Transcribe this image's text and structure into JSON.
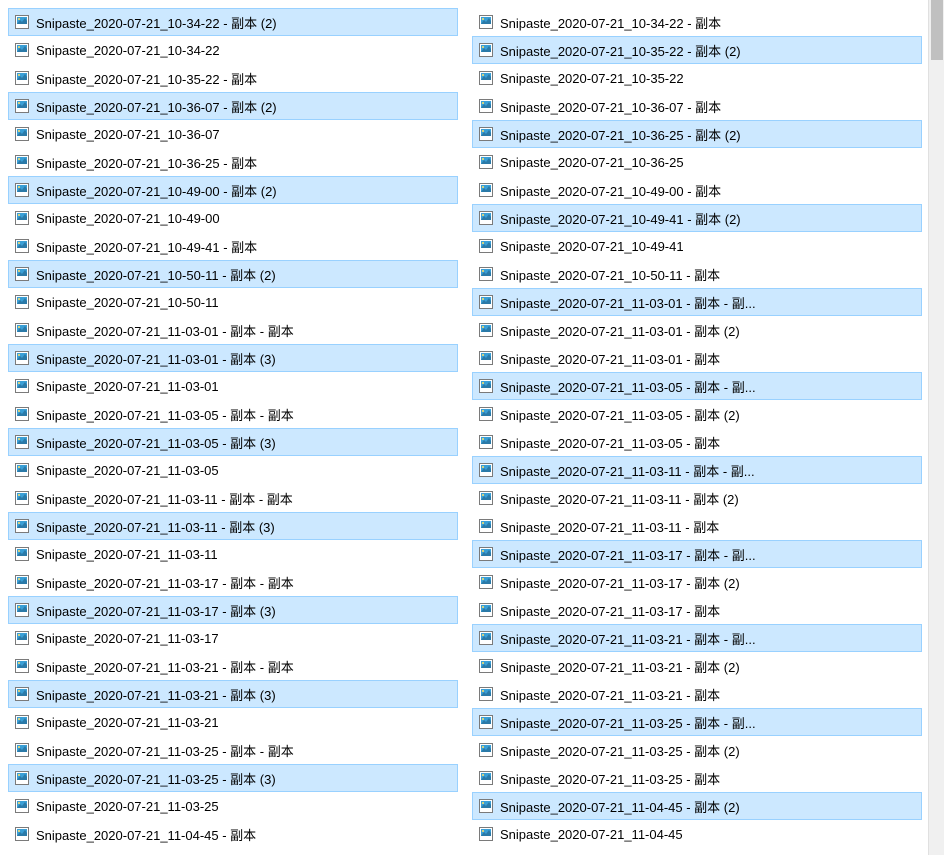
{
  "columns": {
    "left": [
      {
        "label": "Snipaste_2020-07-21_10-34-22 - 副本 (2)",
        "selected": true
      },
      {
        "label": "Snipaste_2020-07-21_10-34-22",
        "selected": false
      },
      {
        "label": "Snipaste_2020-07-21_10-35-22 - 副本",
        "selected": false
      },
      {
        "label": "Snipaste_2020-07-21_10-36-07 - 副本 (2)",
        "selected": true
      },
      {
        "label": "Snipaste_2020-07-21_10-36-07",
        "selected": false
      },
      {
        "label": "Snipaste_2020-07-21_10-36-25 - 副本",
        "selected": false
      },
      {
        "label": "Snipaste_2020-07-21_10-49-00 - 副本 (2)",
        "selected": true
      },
      {
        "label": "Snipaste_2020-07-21_10-49-00",
        "selected": false
      },
      {
        "label": "Snipaste_2020-07-21_10-49-41 - 副本",
        "selected": false
      },
      {
        "label": "Snipaste_2020-07-21_10-50-11 - 副本 (2)",
        "selected": true
      },
      {
        "label": "Snipaste_2020-07-21_10-50-11",
        "selected": false
      },
      {
        "label": "Snipaste_2020-07-21_11-03-01 - 副本 - 副本",
        "selected": false
      },
      {
        "label": "Snipaste_2020-07-21_11-03-01 - 副本 (3)",
        "selected": true
      },
      {
        "label": "Snipaste_2020-07-21_11-03-01",
        "selected": false
      },
      {
        "label": "Snipaste_2020-07-21_11-03-05 - 副本 - 副本",
        "selected": false
      },
      {
        "label": "Snipaste_2020-07-21_11-03-05 - 副本 (3)",
        "selected": true
      },
      {
        "label": "Snipaste_2020-07-21_11-03-05",
        "selected": false
      },
      {
        "label": "Snipaste_2020-07-21_11-03-11 - 副本 - 副本",
        "selected": false
      },
      {
        "label": "Snipaste_2020-07-21_11-03-11 - 副本 (3)",
        "selected": true
      },
      {
        "label": "Snipaste_2020-07-21_11-03-11",
        "selected": false
      },
      {
        "label": "Snipaste_2020-07-21_11-03-17 - 副本 - 副本",
        "selected": false
      },
      {
        "label": "Snipaste_2020-07-21_11-03-17 - 副本 (3)",
        "selected": true
      },
      {
        "label": "Snipaste_2020-07-21_11-03-17",
        "selected": false
      },
      {
        "label": "Snipaste_2020-07-21_11-03-21 - 副本 - 副本",
        "selected": false
      },
      {
        "label": "Snipaste_2020-07-21_11-03-21 - 副本 (3)",
        "selected": true
      },
      {
        "label": "Snipaste_2020-07-21_11-03-21",
        "selected": false
      },
      {
        "label": "Snipaste_2020-07-21_11-03-25 - 副本 - 副本",
        "selected": false
      },
      {
        "label": "Snipaste_2020-07-21_11-03-25 - 副本 (3)",
        "selected": true
      },
      {
        "label": "Snipaste_2020-07-21_11-03-25",
        "selected": false
      },
      {
        "label": "Snipaste_2020-07-21_11-04-45 - 副本",
        "selected": false
      }
    ],
    "right": [
      {
        "label": "Snipaste_2020-07-21_10-34-22 - 副本",
        "selected": false
      },
      {
        "label": "Snipaste_2020-07-21_10-35-22 - 副本 (2)",
        "selected": true
      },
      {
        "label": "Snipaste_2020-07-21_10-35-22",
        "selected": false
      },
      {
        "label": "Snipaste_2020-07-21_10-36-07 - 副本",
        "selected": false
      },
      {
        "label": "Snipaste_2020-07-21_10-36-25 - 副本 (2)",
        "selected": true
      },
      {
        "label": "Snipaste_2020-07-21_10-36-25",
        "selected": false
      },
      {
        "label": "Snipaste_2020-07-21_10-49-00 - 副本",
        "selected": false
      },
      {
        "label": "Snipaste_2020-07-21_10-49-41 - 副本 (2)",
        "selected": true
      },
      {
        "label": "Snipaste_2020-07-21_10-49-41",
        "selected": false
      },
      {
        "label": "Snipaste_2020-07-21_10-50-11 - 副本",
        "selected": false
      },
      {
        "label": "Snipaste_2020-07-21_11-03-01 - 副本 - 副...",
        "selected": true
      },
      {
        "label": "Snipaste_2020-07-21_11-03-01 - 副本 (2)",
        "selected": false
      },
      {
        "label": "Snipaste_2020-07-21_11-03-01 - 副本",
        "selected": false
      },
      {
        "label": "Snipaste_2020-07-21_11-03-05 - 副本 - 副...",
        "selected": true
      },
      {
        "label": "Snipaste_2020-07-21_11-03-05 - 副本 (2)",
        "selected": false
      },
      {
        "label": "Snipaste_2020-07-21_11-03-05 - 副本",
        "selected": false
      },
      {
        "label": "Snipaste_2020-07-21_11-03-11 - 副本 - 副...",
        "selected": true
      },
      {
        "label": "Snipaste_2020-07-21_11-03-11 - 副本 (2)",
        "selected": false
      },
      {
        "label": "Snipaste_2020-07-21_11-03-11 - 副本",
        "selected": false
      },
      {
        "label": "Snipaste_2020-07-21_11-03-17 - 副本 - 副...",
        "selected": true
      },
      {
        "label": "Snipaste_2020-07-21_11-03-17 - 副本 (2)",
        "selected": false
      },
      {
        "label": "Snipaste_2020-07-21_11-03-17 - 副本",
        "selected": false
      },
      {
        "label": "Snipaste_2020-07-21_11-03-21 - 副本 - 副...",
        "selected": true
      },
      {
        "label": "Snipaste_2020-07-21_11-03-21 - 副本 (2)",
        "selected": false
      },
      {
        "label": "Snipaste_2020-07-21_11-03-21 - 副本",
        "selected": false
      },
      {
        "label": "Snipaste_2020-07-21_11-03-25 - 副本 - 副...",
        "selected": true
      },
      {
        "label": "Snipaste_2020-07-21_11-03-25 - 副本 (2)",
        "selected": false
      },
      {
        "label": "Snipaste_2020-07-21_11-03-25 - 副本",
        "selected": false
      },
      {
        "label": "Snipaste_2020-07-21_11-04-45 - 副本 (2)",
        "selected": true
      },
      {
        "label": "Snipaste_2020-07-21_11-04-45",
        "selected": false
      }
    ]
  }
}
